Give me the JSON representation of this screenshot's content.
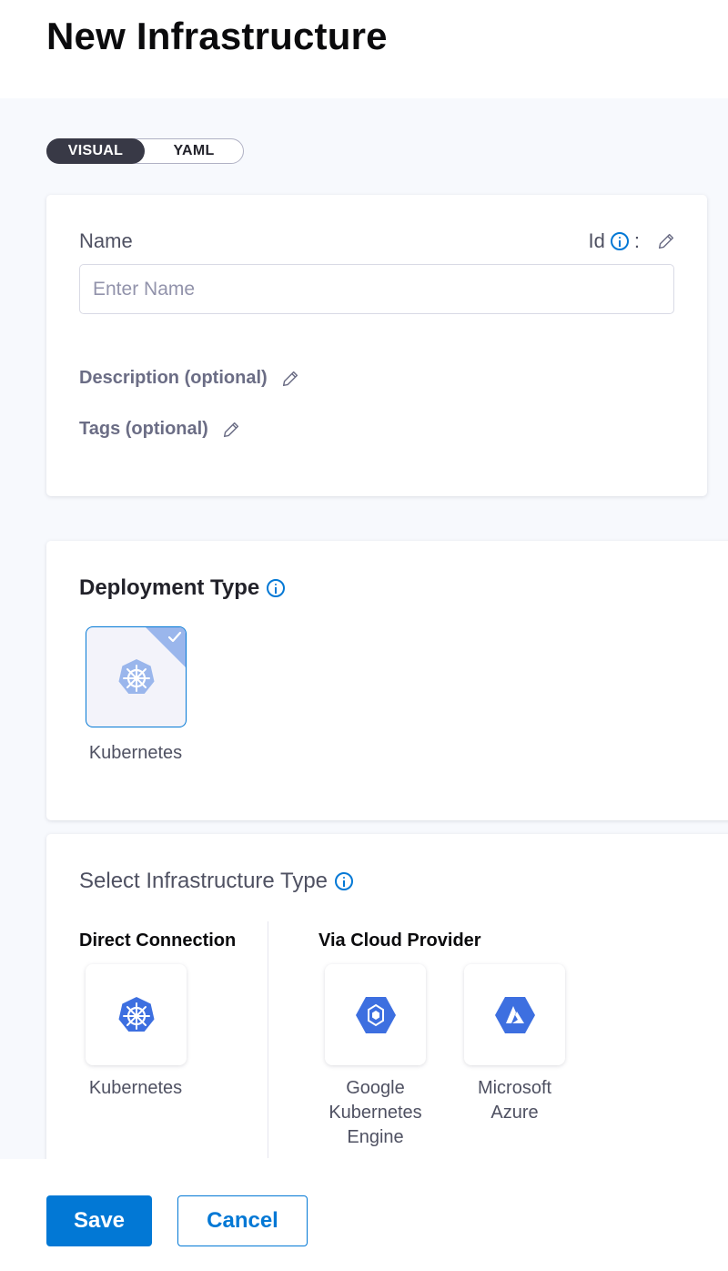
{
  "page": {
    "title": "New Infrastructure"
  },
  "view_toggle": {
    "visual": "VISUAL",
    "yaml": "YAML",
    "selected": "VISUAL"
  },
  "overview": {
    "name_label": "Name",
    "name_placeholder": "Enter Name",
    "name_value": "",
    "id_label": "Id",
    "id_separator": ":",
    "description_label": "Description (optional)",
    "tags_label": "Tags (optional)"
  },
  "deployment_type": {
    "title": "Deployment Type",
    "options": [
      {
        "label": "Kubernetes",
        "icon": "kubernetes-icon",
        "selected": true
      }
    ]
  },
  "infrastructure_type": {
    "title": "Select Infrastructure Type",
    "direct_connection": {
      "title": "Direct Connection",
      "options": [
        {
          "label": "Kubernetes",
          "icon": "kubernetes-icon"
        }
      ]
    },
    "via_cloud_provider": {
      "title": "Via Cloud Provider",
      "options": [
        {
          "label_lines": [
            "Google",
            "Kubernetes",
            "Engine"
          ],
          "icon": "gke-icon"
        },
        {
          "label_lines": [
            "Microsoft",
            "Azure"
          ],
          "icon": "azure-icon"
        }
      ]
    }
  },
  "footer": {
    "save_label": "Save",
    "cancel_label": "Cancel"
  },
  "colors": {
    "primary": "#0278d5",
    "toggle_active_bg": "#383946",
    "k8s_blue": "#3d6fe0",
    "selected_corner": "#9ab6ec"
  }
}
